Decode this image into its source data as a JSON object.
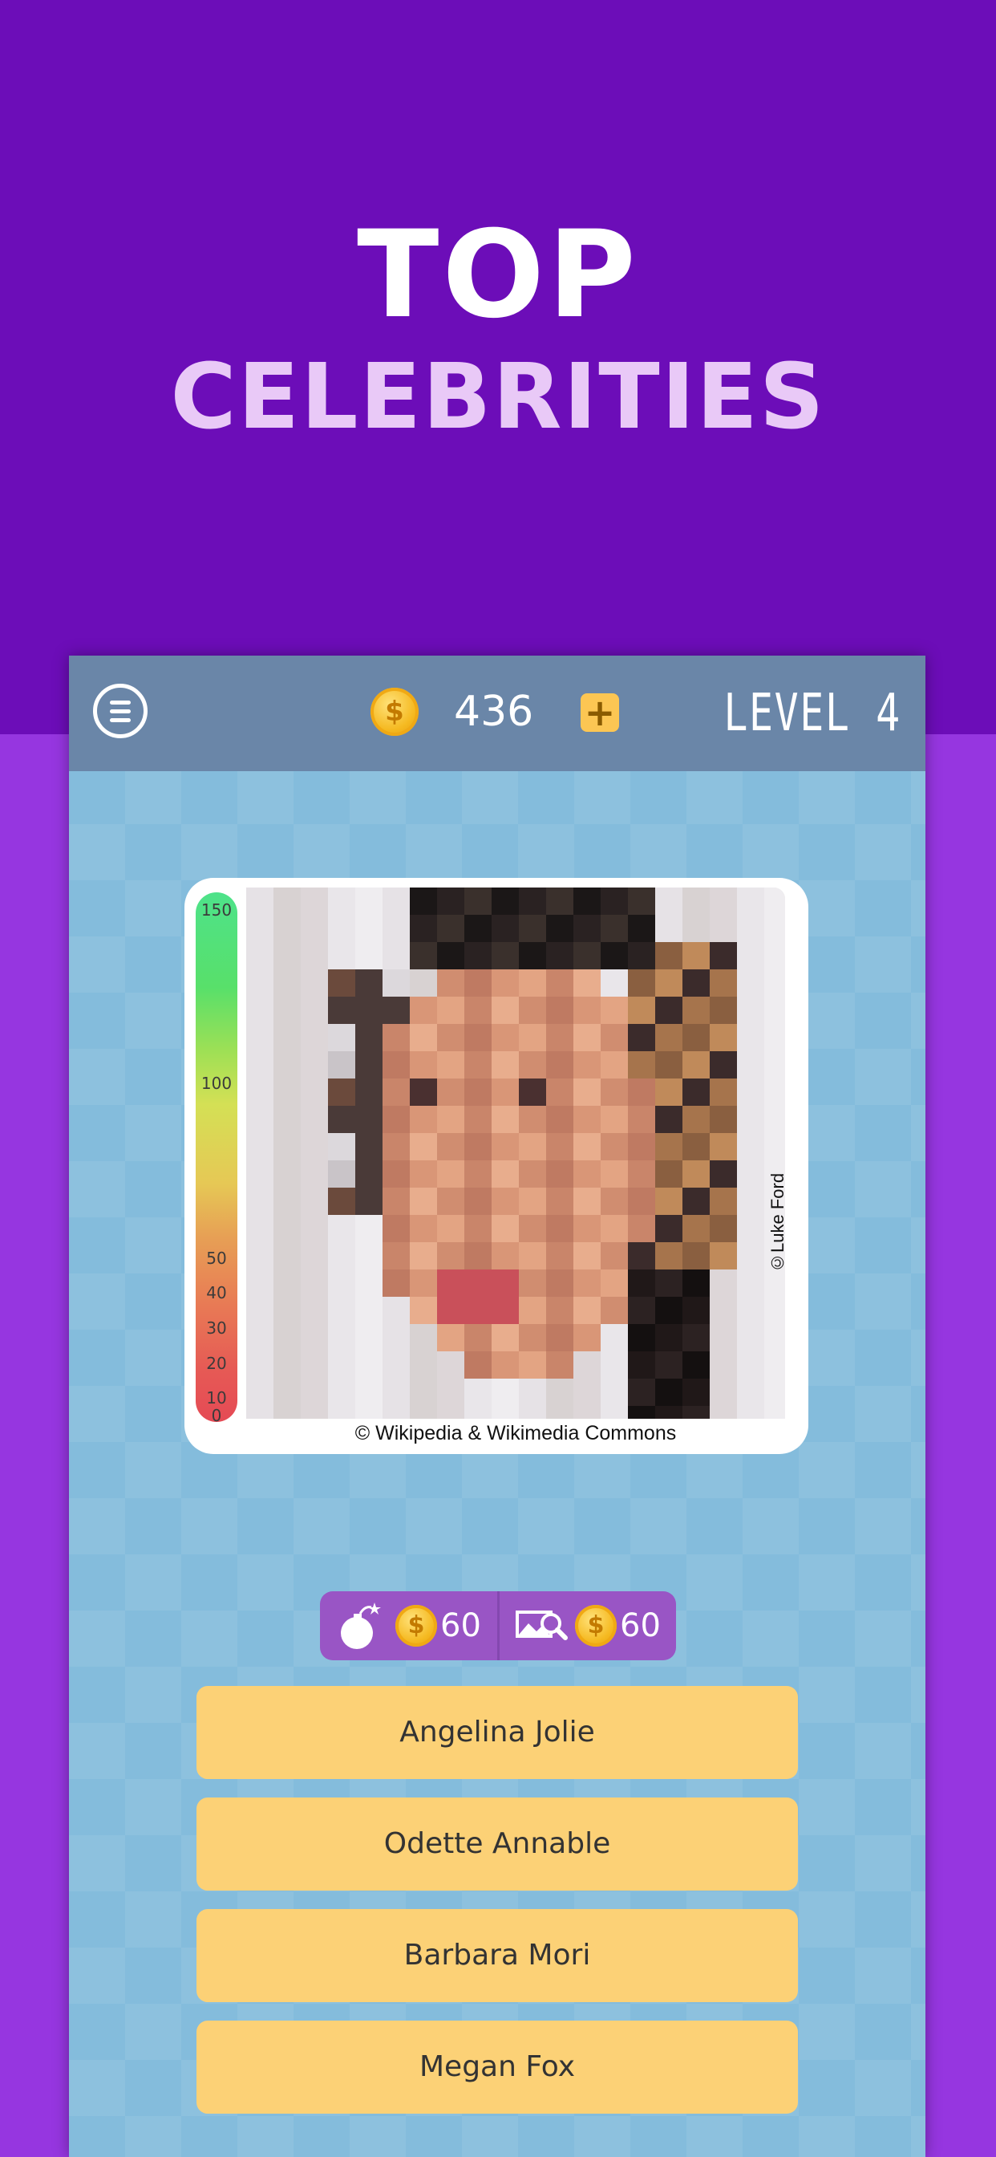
{
  "promo": {
    "title_line1": "TOP",
    "title_line2": "CELEBRITIES"
  },
  "topbar": {
    "menu_icon": "hamburger-circle-icon",
    "coin_count": "436",
    "coin_icon": "dollar-coin-icon",
    "add_coins_label": "+",
    "level_label": "LEVEL 4"
  },
  "meter": {
    "labels": [
      "150",
      "100",
      "50",
      "40",
      "30",
      "20",
      "10",
      "0"
    ]
  },
  "image": {
    "side_credit": "©Luke Ford",
    "bottom_credit": "© Wikipedia & Wikimedia Commons"
  },
  "hints": {
    "bomb_price": "60",
    "reveal_price": "60"
  },
  "answers": [
    "Angelina Jolie",
    "Odette Annable",
    "Barbara Mori",
    "Megan Fox"
  ],
  "colors": {
    "background_top": "#6c0db8",
    "background_bottom": "#9636e0",
    "topbar": "#6a86a8",
    "game_bg": "#84bcdc",
    "answer_button": "#fcd176",
    "hint_bar": "#9955c5",
    "coin": "#f5b920"
  }
}
